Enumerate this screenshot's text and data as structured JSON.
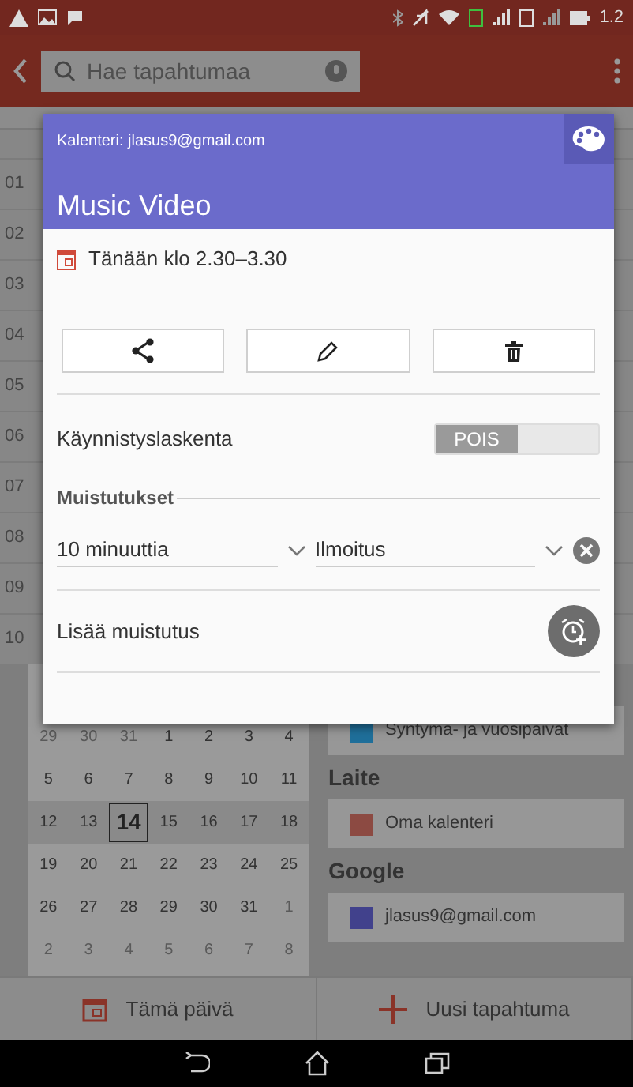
{
  "status_bar": {
    "time": "1.2"
  },
  "toolbar": {
    "search": {
      "placeholder": "Hae tapahtumaa"
    }
  },
  "day_view": {
    "hours": [
      "01",
      "02",
      "03",
      "04",
      "05",
      "06",
      "07",
      "08",
      "09",
      "10"
    ]
  },
  "mini_calendar": {
    "weeks": [
      {
        "current": false,
        "days": [
          {
            "label": "29",
            "other_month": true,
            "selected": false
          },
          {
            "label": "30",
            "other_month": true,
            "selected": false
          },
          {
            "label": "31",
            "other_month": true,
            "selected": false
          },
          {
            "label": "1",
            "other_month": false,
            "selected": false
          },
          {
            "label": "2",
            "other_month": false,
            "selected": false
          },
          {
            "label": "3",
            "other_month": false,
            "selected": false
          },
          {
            "label": "4",
            "other_month": false,
            "selected": false
          }
        ]
      },
      {
        "current": false,
        "days": [
          {
            "label": "5",
            "other_month": false,
            "selected": false
          },
          {
            "label": "6",
            "other_month": false,
            "selected": false
          },
          {
            "label": "7",
            "other_month": false,
            "selected": false
          },
          {
            "label": "8",
            "other_month": false,
            "selected": false
          },
          {
            "label": "9",
            "other_month": false,
            "selected": false
          },
          {
            "label": "10",
            "other_month": false,
            "selected": false
          },
          {
            "label": "11",
            "other_month": false,
            "selected": false
          }
        ]
      },
      {
        "current": true,
        "days": [
          {
            "label": "12",
            "other_month": false,
            "selected": false
          },
          {
            "label": "13",
            "other_month": false,
            "selected": false
          },
          {
            "label": "14",
            "other_month": false,
            "selected": true
          },
          {
            "label": "15",
            "other_month": false,
            "selected": false
          },
          {
            "label": "16",
            "other_month": false,
            "selected": false
          },
          {
            "label": "17",
            "other_month": false,
            "selected": false
          },
          {
            "label": "18",
            "other_month": false,
            "selected": false
          }
        ]
      },
      {
        "current": false,
        "days": [
          {
            "label": "19",
            "other_month": false,
            "selected": false
          },
          {
            "label": "20",
            "other_month": false,
            "selected": false
          },
          {
            "label": "21",
            "other_month": false,
            "selected": false
          },
          {
            "label": "22",
            "other_month": false,
            "selected": false
          },
          {
            "label": "23",
            "other_month": false,
            "selected": false
          },
          {
            "label": "24",
            "other_month": false,
            "selected": false
          },
          {
            "label": "25",
            "other_month": false,
            "selected": false
          }
        ]
      },
      {
        "current": false,
        "days": [
          {
            "label": "26",
            "other_month": false,
            "selected": false
          },
          {
            "label": "27",
            "other_month": false,
            "selected": false
          },
          {
            "label": "28",
            "other_month": false,
            "selected": false
          },
          {
            "label": "29",
            "other_month": false,
            "selected": false
          },
          {
            "label": "30",
            "other_month": false,
            "selected": false
          },
          {
            "label": "31",
            "other_month": false,
            "selected": false
          },
          {
            "label": "1",
            "other_month": true,
            "selected": false
          }
        ]
      },
      {
        "current": false,
        "days": [
          {
            "label": "2",
            "other_month": true,
            "selected": false
          },
          {
            "label": "3",
            "other_month": true,
            "selected": false
          },
          {
            "label": "4",
            "other_month": true,
            "selected": false
          },
          {
            "label": "5",
            "other_month": true,
            "selected": false
          },
          {
            "label": "6",
            "other_month": true,
            "selected": false
          },
          {
            "label": "7",
            "other_month": true,
            "selected": false
          },
          {
            "label": "8",
            "other_month": true,
            "selected": false
          }
        ]
      }
    ]
  },
  "calendars": [
    {
      "items": [
        {
          "name": "Syntymä- ja vuosipäivät",
          "color": "#1f6f9a"
        }
      ]
    },
    {
      "label": "Laite",
      "items": [
        {
          "name": "Oma kalenteri",
          "color": "#8c4a42"
        }
      ]
    },
    {
      "label": "Google",
      "items": [
        {
          "name": "jlasus9@gmail.com",
          "color": "#41418c"
        }
      ]
    }
  ],
  "bottom_bar": [
    {
      "kind": "today",
      "label": "Tämä päivä"
    },
    {
      "kind": "new",
      "label": "Uusi tapahtuma"
    }
  ],
  "dialog": {
    "calendar_label": "Kalenteri: jlasus9@gmail.com",
    "title": "Music Video",
    "time": "Tänään klo 2.30–3.30",
    "actions": [
      {
        "kind": "share"
      },
      {
        "kind": "edit"
      },
      {
        "kind": "delete"
      }
    ],
    "countdown": {
      "label": "Käynnistyslaskenta",
      "state_text": "POIS",
      "on": false
    },
    "reminders_heading": "Muistutukset",
    "reminders": [
      {
        "time": "10 minuuttia",
        "method": "Ilmoitus"
      }
    ],
    "add_reminder": "Lisää muistutus"
  }
}
